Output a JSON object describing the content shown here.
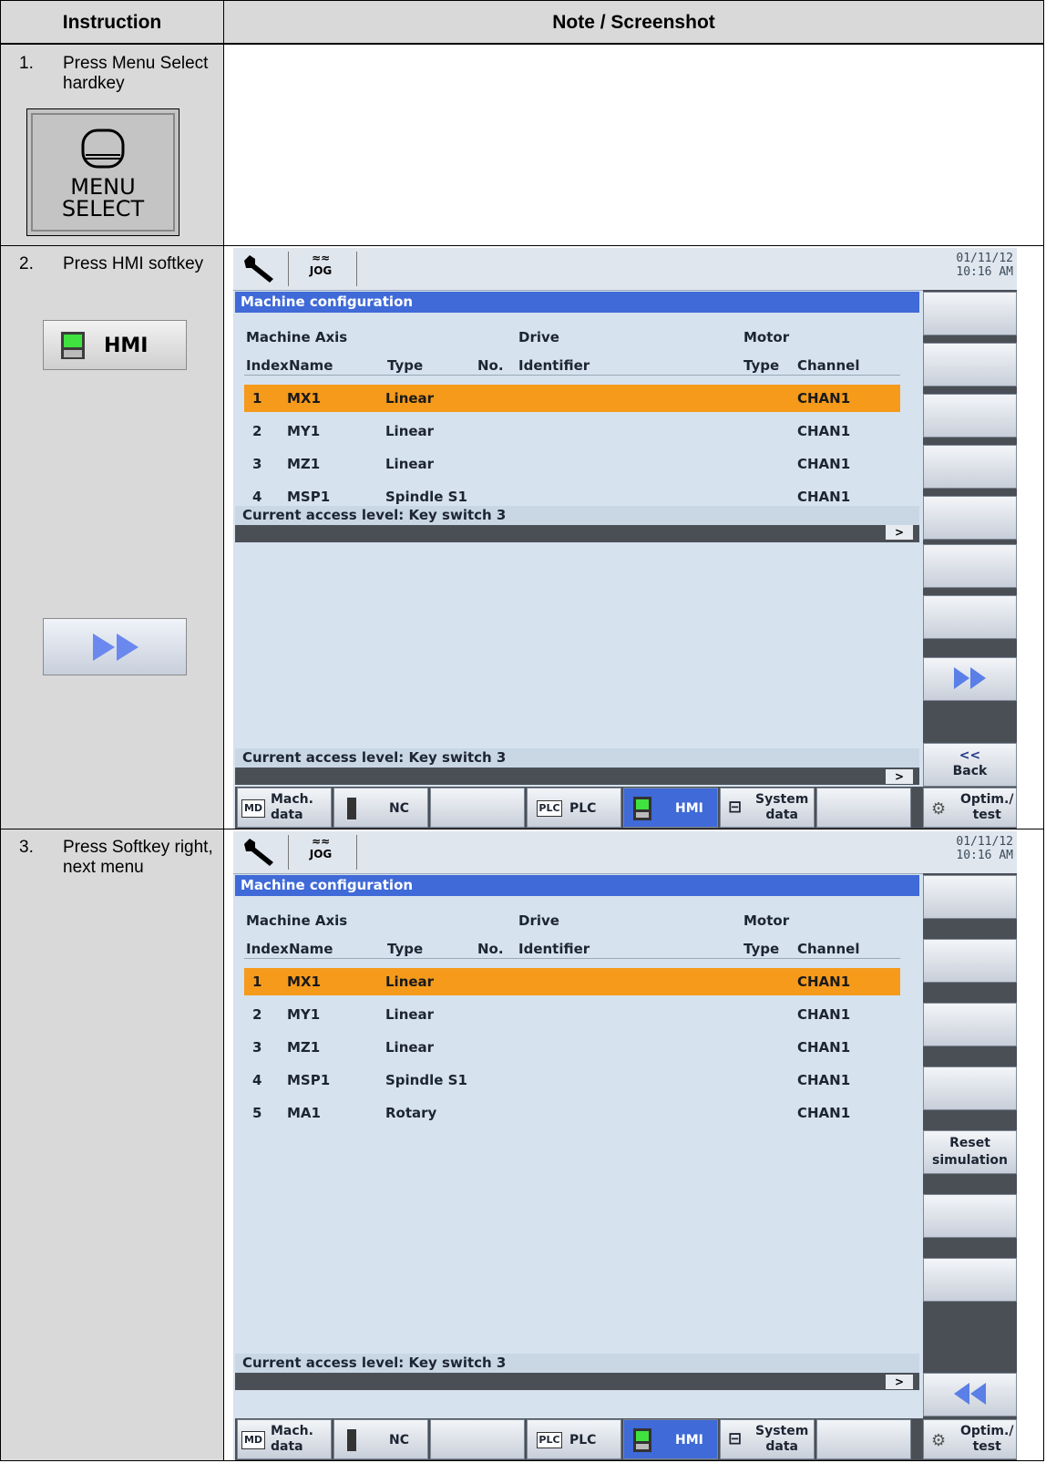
{
  "header": {
    "instruction": "Instruction",
    "note": "Note / Screenshot"
  },
  "steps": [
    {
      "num": "1.",
      "text": "Press Menu Select hardkey",
      "key_label_1": "MENU",
      "key_label_2": "SELECT"
    },
    {
      "num": "2.",
      "text": "Press HMI softkey",
      "key_label": "HMI"
    },
    {
      "num": "3.",
      "text": "Press Softkey right, next menu"
    }
  ],
  "screen": {
    "mode": "JOG",
    "date": "01/11/12",
    "time": "10:16 AM",
    "title": "Machine configuration",
    "group_headers": {
      "machine_axis": "Machine Axis",
      "drive": "Drive",
      "motor": "Motor"
    },
    "columns": {
      "index": "Index",
      "name": "Name",
      "type": "Type",
      "no": "No.",
      "identifier": "Identifier",
      "motor_type": "Type",
      "channel": "Channel"
    },
    "rows": [
      {
        "index": "1",
        "name": "MX1",
        "type": "Linear",
        "channel": "CHAN1"
      },
      {
        "index": "2",
        "name": "MY1",
        "type": "Linear",
        "channel": "CHAN1"
      },
      {
        "index": "3",
        "name": "MZ1",
        "type": "Linear",
        "channel": "CHAN1"
      },
      {
        "index": "4",
        "name": "MSP1",
        "type": "Spindle S1",
        "channel": "CHAN1"
      },
      {
        "index": "5",
        "name": "MA1",
        "type": "Rotary",
        "channel": "CHAN1"
      }
    ],
    "status": "Current access level: Key switch 3",
    "status_arrow": ">",
    "back_arrow": "<<",
    "back_label": "Back",
    "reset_label_1": "Reset",
    "reset_label_2": "simulation",
    "hsk": {
      "mach_1": "Mach.",
      "mach_2": "data",
      "md_icon": "MD",
      "nc": "NC",
      "plc_icon": "PLC",
      "plc": "PLC",
      "hmi": "HMI",
      "system_1": "System",
      "system_2": "data",
      "optim_1": "Optim./",
      "optim_2": "test"
    }
  },
  "colors": {
    "selected_row": "#f59a1b",
    "title_bar": "#3f6ad8",
    "screen_bg": "#d6e2ee"
  },
  "icons": [
    "wrench-icon",
    "jog-mode-icon",
    "screen-icon",
    "hmi-panel-icon",
    "nc-icon",
    "system-tree-icon",
    "optim-icon",
    "next-arrow-icon",
    "back-arrow-icon"
  ]
}
